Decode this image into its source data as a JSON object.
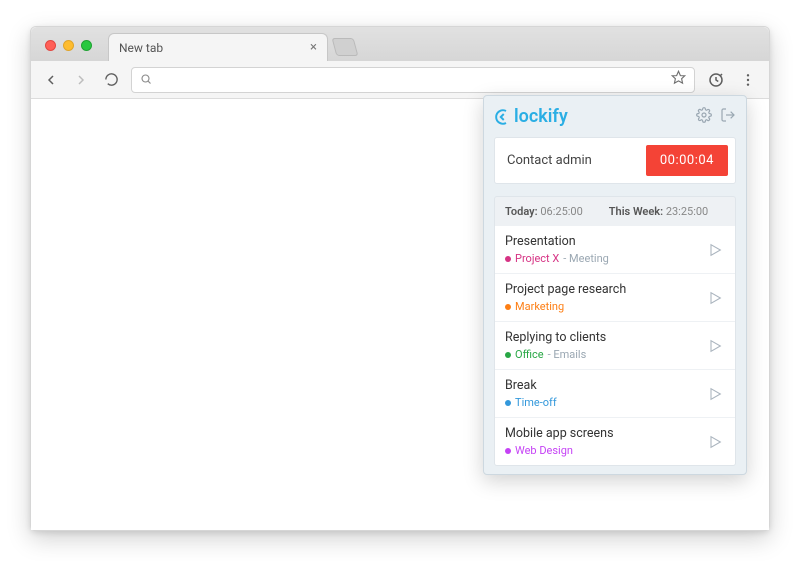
{
  "browser": {
    "tab_title": "New tab",
    "omnibox_value": ""
  },
  "popup": {
    "brand": "lockify",
    "current": {
      "description": "Contact admin",
      "timer": "00:00:04"
    },
    "summary": {
      "today_label": "Today:",
      "today_value": "06:25:00",
      "week_label": "This Week:",
      "week_value": "23:25:00"
    },
    "entries": [
      {
        "title": "Presentation",
        "project": "Project X",
        "task": "Meeting",
        "color": "#d63384"
      },
      {
        "title": "Project page research",
        "project": "Marketing",
        "task": "",
        "color": "#fd7e14"
      },
      {
        "title": "Replying to clients",
        "project": "Office",
        "task": "Emails",
        "color": "#28a745"
      },
      {
        "title": "Break",
        "project": "Time-off",
        "task": "",
        "color": "#3398db"
      },
      {
        "title": "Mobile app screens",
        "project": "Web Design",
        "task": "",
        "color": "#c542f5"
      }
    ]
  }
}
